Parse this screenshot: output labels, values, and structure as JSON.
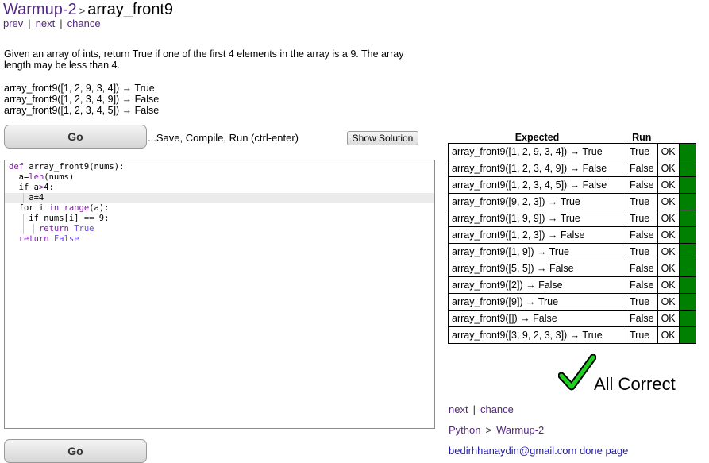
{
  "header": {
    "section": "Warmup-2",
    "separator": ">",
    "title": "array_front9",
    "nav": {
      "prev": "prev",
      "next": "next",
      "chance": "chance",
      "bar": "|"
    }
  },
  "prompt": {
    "text": "Given an array of ints, return True if one of the first 4 elements in the array is a 9. The array length may be less than 4.",
    "examples": [
      "array_front9([1, 2, 9, 3, 4]) → True",
      "array_front9([1, 2, 3, 4, 9]) → False",
      "array_front9([1, 2, 3, 4, 5]) → False"
    ]
  },
  "controls": {
    "go_label": "Go",
    "save_text": "...Save, Compile, Run (ctrl-enter)",
    "show_solution_label": "Show Solution"
  },
  "editor": {
    "lines": [
      "def array_front9(nums):",
      "  a=len(nums)",
      "  if a>4:",
      "    a=4",
      "  for i in range(a):",
      "    if nums[i] == 9:",
      "      return True",
      "  return False"
    ],
    "active_line": 3
  },
  "results": {
    "headers": {
      "expected": "Expected",
      "run": "Run"
    },
    "rows": [
      {
        "expected": "array_front9([1, 2, 9, 3, 4]) → True",
        "run": "True",
        "status": "OK"
      },
      {
        "expected": "array_front9([1, 2, 3, 4, 9]) → False",
        "run": "False",
        "status": "OK"
      },
      {
        "expected": "array_front9([1, 2, 3, 4, 5]) → False",
        "run": "False",
        "status": "OK"
      },
      {
        "expected": "array_front9([9, 2, 3]) → True",
        "run": "True",
        "status": "OK"
      },
      {
        "expected": "array_front9([1, 9, 9]) → True",
        "run": "True",
        "status": "OK"
      },
      {
        "expected": "array_front9([1, 2, 3]) → False",
        "run": "False",
        "status": "OK"
      },
      {
        "expected": "array_front9([1, 9]) → True",
        "run": "True",
        "status": "OK"
      },
      {
        "expected": "array_front9([5, 5]) → False",
        "run": "False",
        "status": "OK"
      },
      {
        "expected": "array_front9([2]) → False",
        "run": "False",
        "status": "OK"
      },
      {
        "expected": "array_front9([9]) → True",
        "run": "True",
        "status": "OK"
      },
      {
        "expected": "array_front9([]) → False",
        "run": "False",
        "status": "OK"
      },
      {
        "expected": "array_front9([3, 9, 2, 3, 3]) → True",
        "run": "True",
        "status": "OK"
      }
    ],
    "pass_color": "#008000"
  },
  "summary": {
    "label": "All Correct",
    "icon": "checkmark-icon"
  },
  "bottom": {
    "next": "next",
    "chance": "chance",
    "bar": "|",
    "python": "Python",
    "separator": ">",
    "section": "Warmup-2",
    "done_text": "bedirhhanaydin@gmail.com done page"
  },
  "colors": {
    "link": "#55287f",
    "keyword": "#7a1fa2",
    "boolean": "#6b4ce6",
    "check": "#1fd11f"
  }
}
